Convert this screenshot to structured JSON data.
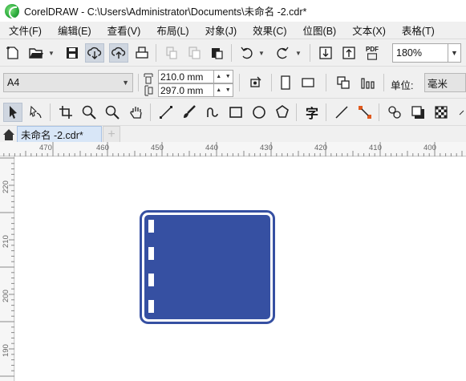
{
  "window": {
    "title": "CorelDRAW - C:\\Users\\Administrator\\Documents\\未命名 -2.cdr*"
  },
  "menu": {
    "items": [
      "文件(F)",
      "编辑(E)",
      "查看(V)",
      "布局(L)",
      "对象(J)",
      "效果(C)",
      "位图(B)",
      "文本(X)",
      "表格(T)"
    ]
  },
  "toolbar": {
    "zoom": "180%",
    "pdf_label": "PDF",
    "icons": [
      "new-document-icon",
      "open-folder-icon",
      "save-icon",
      "cloud-download-icon",
      "cloud-upload-icon",
      "print-icon",
      "cut-icon",
      "copy-icon",
      "paste-icon",
      "undo-icon",
      "redo-icon",
      "import-icon",
      "export-icon",
      "publish-pdf-icon"
    ]
  },
  "property_bar": {
    "page_preset": "A4",
    "width": "210.0 mm",
    "height": "297.0 mm",
    "unit_label": "单位:",
    "unit_value": "毫米"
  },
  "tools": [
    "pick-tool-icon",
    "shape-tool-icon",
    "crop-tool-icon",
    "zoom-tool-icon",
    "zoom-out-tool-icon",
    "pan-tool-icon",
    "freehand-tool-icon",
    "artistic-media-tool-icon",
    "smart-drawing-tool-icon",
    "rectangle-tool-icon",
    "ellipse-tool-icon",
    "polygon-tool-icon",
    "text-tool-icon",
    "parallel-dimension-tool-icon",
    "connector-tool-icon",
    "blend-tool-icon",
    "drop-shadow-tool-icon",
    "transparency-tool-icon"
  ],
  "text_tool_glyph": "字",
  "tabs": {
    "doc_tab": "未命名 -2.cdr*",
    "add_tab": "+"
  },
  "ruler": {
    "h_labels": [
      "470",
      "460",
      "450",
      "440",
      "430",
      "420",
      "410",
      "400"
    ],
    "v_labels": [
      "220",
      "210",
      "200",
      "190"
    ]
  },
  "drawing": {
    "fill_color": "#3650a2",
    "outline_color": "#3650a2",
    "notch_color": "#ffffff"
  }
}
